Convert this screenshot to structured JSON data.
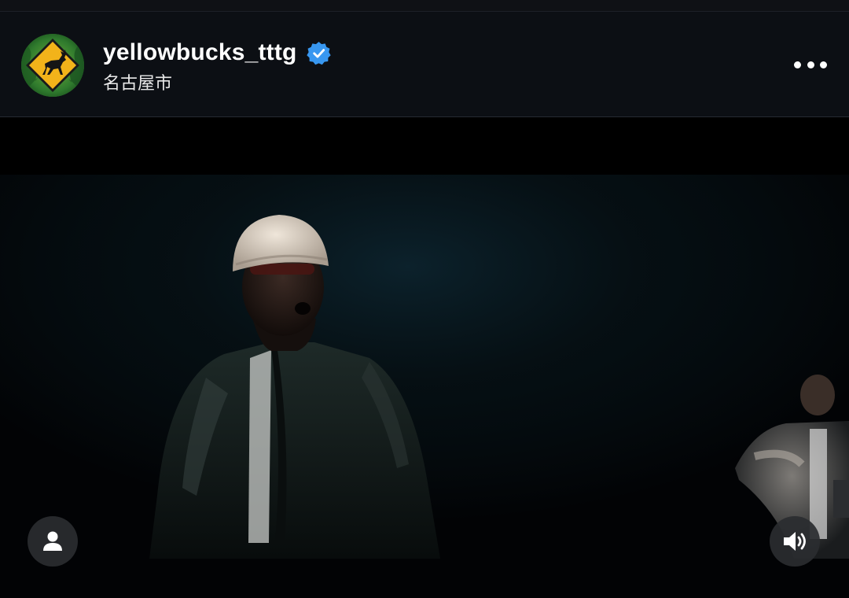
{
  "post": {
    "username": "yellowbucks_tttg",
    "verified": true,
    "location": "名古屋市"
  },
  "icons": {
    "avatar": "deer-crossing-sign-avatar",
    "verified": "verified-badge-icon",
    "more": "more-options-icon",
    "tag": "user-tag-icon",
    "audio": "speaker-sound-on-icon"
  },
  "colors": {
    "header_bg": "#0c0f14",
    "verified_blue": "#3897f0",
    "avatar_sign_yellow": "#f2b31a",
    "button_bg": "#2a2c30"
  }
}
